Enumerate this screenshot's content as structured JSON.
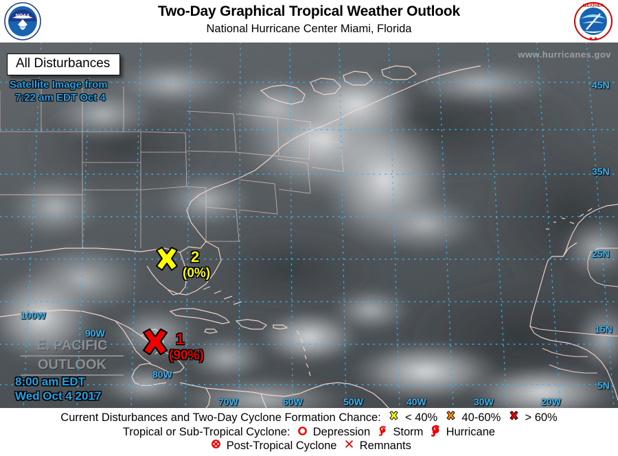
{
  "header": {
    "title": "Two-Day Graphical Tropical Weather Outlook",
    "subtitle": "National Hurricane Center  Miami, Florida",
    "noaa_logo_alt": "NOAA",
    "nws_logo_alt": "NATIONAL WEATHER SERVICE"
  },
  "map": {
    "disturbances_button": "All Disturbances",
    "satellite_line1": "Satellite Image from",
    "satellite_line2": "7:22 am EDT Oct 4",
    "url": "www.hurricanes.gov",
    "epacific_line1": "E. PACIFIC",
    "epacific_line2": "OUTLOOK",
    "timestamp_line1": "8:00 am EDT",
    "timestamp_line2": "Wed Oct 4 2017",
    "lat_labels": [
      "45N",
      "35N",
      "25N",
      "15N",
      "5N"
    ],
    "lon_labels_bottom": [
      "70W",
      "60W",
      "50W",
      "40W",
      "30W",
      "20W"
    ],
    "lon_labels_left": [
      "100W",
      "90W",
      "80W"
    ],
    "colors": {
      "grid": "#33b5f5",
      "coastline": "#f7d9cf",
      "label_cyan": "#22a3e8",
      "low_chance": "#ffff00",
      "medium_chance": "#ff8c00",
      "high_chance": "#ee0000"
    },
    "disturbances": [
      {
        "id": "1",
        "number": "1",
        "percent": "(90%)",
        "chance": "high",
        "marker": "x-marker",
        "color": "#ee0000"
      },
      {
        "id": "2",
        "number": "2",
        "percent": "(0%)",
        "chance": "low",
        "marker": "x-marker",
        "color": "#ffff00"
      }
    ]
  },
  "legend": {
    "row1_label": "Current Disturbances and Two-Day Cyclone Formation Chance:",
    "row1_items": [
      {
        "icon": "x-marker-yellow",
        "label": "< 40%",
        "color": "#ffff00"
      },
      {
        "icon": "x-marker-orange",
        "label": "40-60%",
        "color": "#ff8c00"
      },
      {
        "icon": "x-marker-red",
        "label": "> 60%",
        "color": "#ee0000"
      }
    ],
    "row2_label": "Tropical or Sub-Tropical Cyclone:",
    "row2_items": [
      {
        "icon": "circle-outline",
        "label": "Depression",
        "color": "#ee0000"
      },
      {
        "icon": "storm-swirl",
        "label": "Storm",
        "color": "#ee0000"
      },
      {
        "icon": "hurricane-swirl",
        "label": "Hurricane",
        "color": "#ee0000"
      }
    ],
    "row3_items": [
      {
        "icon": "circle-x",
        "label": "Post-Tropical Cyclone",
        "color": "#ee0000"
      },
      {
        "icon": "x-outline",
        "label": "Remnants",
        "color": "#ee0000"
      }
    ]
  }
}
